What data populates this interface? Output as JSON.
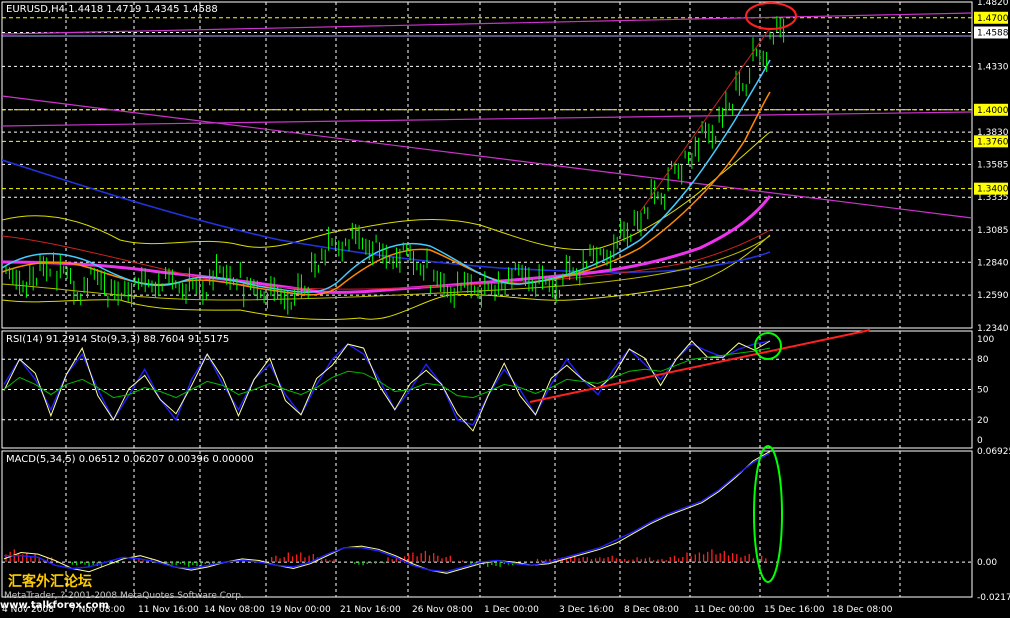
{
  "colors": {
    "background": "#000000",
    "grid": "#ffffff",
    "candles": "#00ff00",
    "price_line_highlight": "#ffff00",
    "trend_magenta": "#cc33cc",
    "annotation_red": "#ff2020",
    "annotation_green": "#00ff00",
    "rsi_line": "#2020ff",
    "stoch_main": "#ffff99",
    "stoch_signal": "#00bb00",
    "macd_line": "#ffff99",
    "macd_signal": "#2020ff",
    "macd_hist": "#ff2020"
  },
  "chart_data": [
    {
      "type": "line",
      "panel": "price",
      "title": "EURUSD,H4  1.4418 1.4719 1.4345 1.4588",
      "symbol": "EURUSD",
      "timeframe": "H4",
      "ohlc": {
        "open": 1.4418,
        "high": 1.4719,
        "low": 1.4345,
        "close": 1.4588
      },
      "y_ticks": [
        "1.4820",
        "1.4588",
        "1.4330",
        "1.4000",
        "1.3830",
        "1.3585",
        "1.3335",
        "1.3085",
        "1.2840",
        "1.2590",
        "1.2340"
      ],
      "highlight_levels": [
        "1.4700",
        "1.4000",
        "1.3760",
        "1.3400"
      ],
      "current_price_label": "1.4588",
      "ylim": [
        1.234,
        1.482
      ],
      "grid": true,
      "series": [
        {
          "values": [
            1.272,
            1.268,
            1.281,
            1.276,
            1.262,
            1.274,
            1.259,
            1.264,
            1.268,
            1.271,
            1.266,
            1.262,
            1.275,
            1.272,
            1.265,
            1.261,
            1.257,
            1.262,
            1.284,
            1.297,
            1.303,
            1.297,
            1.287,
            1.29,
            1.281,
            1.269,
            1.263,
            1.267,
            1.262,
            1.268,
            1.276,
            1.27,
            1.266,
            1.276,
            1.287,
            1.29,
            1.305,
            1.319,
            1.336,
            1.352,
            1.366,
            1.382,
            1.4,
            1.421,
            1.44,
            1.459
          ]
        },
        {
          "values": [
            1.268,
            1.266,
            1.276,
            1.276,
            1.266,
            1.268,
            1.262,
            1.261,
            1.265,
            1.268,
            1.266,
            1.263,
            1.27,
            1.271,
            1.266,
            1.262,
            1.259,
            1.26,
            1.272,
            1.286,
            1.296,
            1.296,
            1.291,
            1.29,
            1.285,
            1.276,
            1.268,
            1.266,
            1.264,
            1.266,
            1.271,
            1.27,
            1.268,
            1.272,
            1.28,
            1.286,
            1.297,
            1.309,
            1.324,
            1.339,
            1.353,
            1.368,
            1.384,
            1.401,
            1.418,
            1.434
          ]
        },
        {
          "values": [
            1.27,
            1.27,
            1.272,
            1.274,
            1.273,
            1.272,
            1.27,
            1.269,
            1.268,
            1.268,
            1.268,
            1.267,
            1.267,
            1.268,
            1.268,
            1.267,
            1.266,
            1.266,
            1.268,
            1.272,
            1.277,
            1.281,
            1.283,
            1.284,
            1.284,
            1.282,
            1.28,
            1.278,
            1.276,
            1.275,
            1.275,
            1.275,
            1.275,
            1.276,
            1.278,
            1.281,
            1.285,
            1.29,
            1.297,
            1.305,
            1.314,
            1.324,
            1.334
          ]
        },
        {
          "values": [
            1.298,
            1.295,
            1.292,
            1.289,
            1.287,
            1.285,
            1.283,
            1.281,
            1.28,
            1.279,
            1.278,
            1.277,
            1.277,
            1.276,
            1.276,
            1.276,
            1.276,
            1.276,
            1.277,
            1.278,
            1.279,
            1.28,
            1.281,
            1.281,
            1.282,
            1.282,
            1.282,
            1.282,
            1.282,
            1.282,
            1.283,
            1.283,
            1.283,
            1.284,
            1.285,
            1.287,
            1.289,
            1.291,
            1.293,
            1.295
          ]
        }
      ]
    },
    {
      "type": "line",
      "panel": "oscillator",
      "title": "RSI(14) 91.2914  Sto(9,3,3) 88.7604 91.5175",
      "rsi": {
        "period": 14,
        "value": 91.2914
      },
      "stochastic": {
        "params": "9,3,3",
        "main": 88.7604,
        "signal": 91.5175
      },
      "y_ticks": [
        "100",
        "80",
        "50",
        "20",
        "0"
      ],
      "ylim": [
        0,
        100
      ],
      "series": [
        {
          "values": [
            55,
            80,
            60,
            30,
            65,
            85,
            50,
            20,
            45,
            70,
            40,
            20,
            60,
            85,
            55,
            30,
            60,
            75,
            45,
            25,
            55,
            80,
            95,
            85,
            60,
            30,
            50,
            75,
            55,
            20,
            15,
            45,
            70,
            50,
            25,
            55,
            80,
            60,
            45,
            70,
            90,
            75,
            60,
            80,
            95,
            88,
            82,
            90,
            95,
            98
          ]
        },
        {
          "values": [
            50,
            62,
            55,
            45,
            55,
            60,
            52,
            42,
            45,
            52,
            48,
            42,
            50,
            58,
            54,
            45,
            50,
            56,
            50,
            45,
            52,
            62,
            68,
            66,
            58,
            48,
            50,
            56,
            54,
            44,
            42,
            48,
            55,
            52,
            46,
            52,
            60,
            58,
            56,
            62,
            68,
            70,
            68,
            74,
            80,
            82,
            84,
            86,
            88,
            91
          ]
        }
      ],
      "annotations": [
        "rising red support trend line",
        "green circle around final RSI highs"
      ]
    },
    {
      "type": "bar",
      "panel": "macd",
      "title": "MACD(5,34,5) 0.06512 0.06207 0.00396 0.00000",
      "macd": {
        "params": "5,34,5",
        "main": 0.06512,
        "signal": 0.06207,
        "histogram": 0.00396,
        "extra": 0.0
      },
      "y_ticks": [
        "0.06925",
        "0.00",
        "-0.02175"
      ],
      "ylim": [
        -0.02175,
        0.06925
      ],
      "series": [
        {
          "values": [
            0.002,
            0.006,
            0.005,
            0.001,
            -0.004,
            -0.006,
            -0.002,
            0.002,
            0.004,
            0.001,
            -0.003,
            -0.005,
            -0.003,
            0.0,
            0.002,
            0.001,
            -0.002,
            -0.004,
            -0.001,
            0.004,
            0.009,
            0.01,
            0.008,
            0.004,
            -0.001,
            -0.005,
            -0.007,
            -0.004,
            -0.001,
            0.001,
            0.0,
            -0.002,
            -0.001,
            0.002,
            0.005,
            0.008,
            0.012,
            0.018,
            0.024,
            0.029,
            0.033,
            0.037,
            0.044,
            0.053,
            0.063,
            0.069
          ]
        },
        {
          "values": [
            0.004,
            0.004,
            0.003,
            -0.002,
            -0.004,
            -0.003,
            0.0,
            0.003,
            0.002,
            0.0,
            -0.003,
            -0.004,
            -0.002,
            0.0,
            0.001,
            0.0,
            -0.002,
            -0.003,
            0.0,
            0.005,
            0.009,
            0.009,
            0.007,
            0.003,
            -0.002,
            -0.005,
            -0.006,
            -0.003,
            0.0,
            0.001,
            -0.001,
            -0.002,
            0.0,
            0.003,
            0.006,
            0.009,
            0.014,
            0.019,
            0.025,
            0.03,
            0.034,
            0.038,
            0.045,
            0.054,
            0.062,
            0.068
          ]
        }
      ],
      "histogram": [
        0.008,
        0.006,
        0.003,
        0.0,
        -0.002,
        -0.003,
        -0.001,
        0.0,
        0.002,
        -0.001,
        -0.002,
        -0.003,
        -0.002,
        0.0,
        0.0,
        0.001,
        0.004,
        0.006,
        0.005,
        0.002,
        0.0,
        -0.002,
        -0.001,
        0.003,
        0.006,
        0.007,
        0.004,
        0.001,
        -0.002,
        -0.003,
        -0.002,
        0.0,
        0.002,
        0.003,
        0.004,
        0.003,
        0.004,
        0.002,
        0.003,
        0.002,
        0.004,
        0.006,
        0.008,
        0.007,
        0.005,
        0.004
      ],
      "annotations": [
        "green vertical ellipse around latest MACD peak"
      ]
    }
  ],
  "x_axis": {
    "tick_labels": [
      "4 Nov 2008",
      "7 Nov 08:00",
      "11 Nov 16:00",
      "14 Nov 08:00",
      "19 Nov 00:00",
      "21 Nov 16:00",
      "26 Nov 08:00",
      "1 Dec 00:00",
      "3 Dec 16:00",
      "8 Dec 08:00",
      "11 Dec 00:00",
      "15 Dec 16:00",
      "18 Dec 08:00"
    ]
  },
  "footer": {
    "copyright": "MetaTrader, ? 2001-2008 MetaQuotes Software Corp.",
    "watermark_cn": "汇客外汇论坛",
    "watermark_url": "www.talkforex.com"
  }
}
